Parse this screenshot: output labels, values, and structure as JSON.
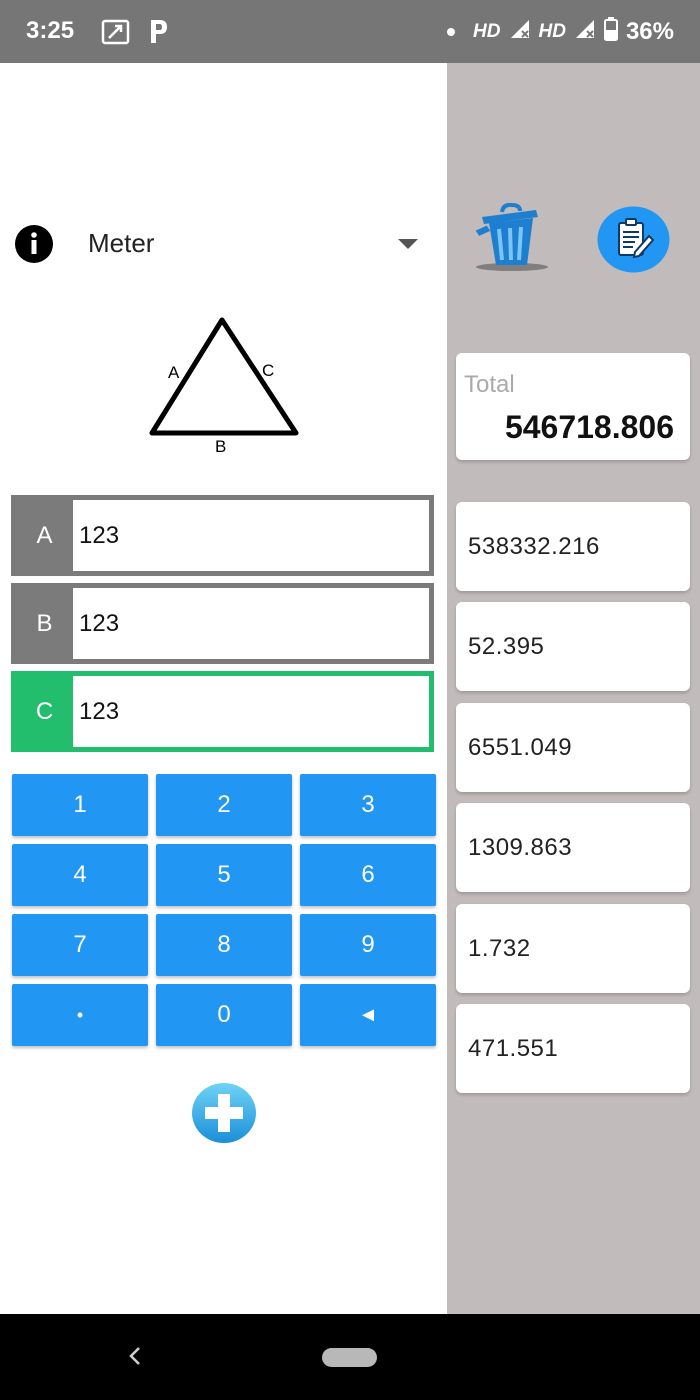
{
  "status_bar": {
    "time": "3:25",
    "icons": [
      "picture-in-picture-icon",
      "parking-icon",
      "dot-icon",
      "signal-icon",
      "signal-icon",
      "battery-icon"
    ],
    "network_1": "HD",
    "network_2": "HD",
    "battery": "36%"
  },
  "unit": {
    "selected": "Meter",
    "info_icon": "info-icon",
    "caret_icon": "chevron-down-icon"
  },
  "diagram": {
    "label_a": "A",
    "label_b": "B",
    "label_c": "C"
  },
  "fields": [
    {
      "tag": "A",
      "value": "123",
      "active": false
    },
    {
      "tag": "B",
      "value": "123",
      "active": false
    },
    {
      "tag": "C",
      "value": "123",
      "active": true
    }
  ],
  "keypad": [
    [
      "1",
      "2",
      "3"
    ],
    [
      "4",
      "5",
      "6"
    ],
    [
      "7",
      "8",
      "9"
    ],
    [
      "•",
      "0",
      "◄"
    ]
  ],
  "total": {
    "label": "Total",
    "value": "546718.806"
  },
  "results": [
    "538332.216",
    "52.395",
    "6551.049",
    "1309.863",
    "1.732",
    "471.551"
  ],
  "colors": {
    "accent": "#2196f3",
    "active": "#22bd6d",
    "inactive": "#7b7b7b",
    "right_panel": "#c2bbbb"
  }
}
